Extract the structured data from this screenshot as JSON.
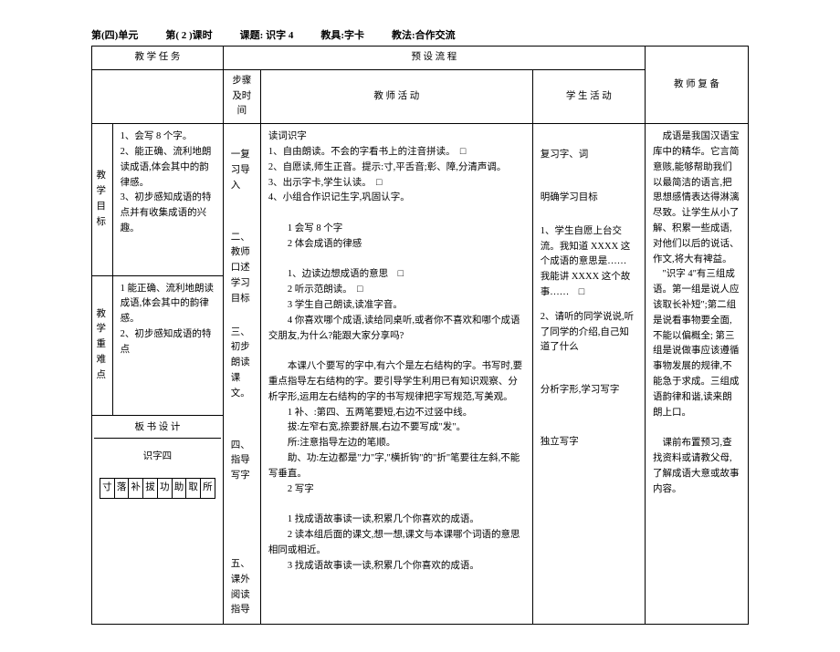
{
  "header": {
    "unit": "第(四)单元",
    "period": "第( 2 )课时",
    "topic": "课题: 识字 4",
    "tool": "教具:字卡",
    "method": "教法:合作交流"
  },
  "colHeaders": {
    "task": "教 学 任 务",
    "flow": "预 设 流 程",
    "step": "步骤及时间",
    "teacher": "教 师 活 动",
    "student": "学 生 活 动",
    "notes": "教 师 复 备"
  },
  "rowHeaders": {
    "goal": "教学目标",
    "keypoint": "教学重难点",
    "board": "板 书 设 计"
  },
  "goal": {
    "l1": "1、会写 8 个字。",
    "l2": "2、能正确、流利地朗读成语,体会其中的韵律感。",
    "l3": "3、初步感知成语的特点并有收集成语的兴趣。"
  },
  "keypoint": {
    "l1": "1 能正确、流利地朗读成语,体会其中的韵律感。",
    "l2": "2、初步感知成语的特点"
  },
  "board": {
    "title": "识字四",
    "c1": "寸",
    "c2": "落",
    "c3": "补",
    "c4": "拔",
    "c5": "功",
    "c6": "助",
    "c7": "取",
    "c8": "所"
  },
  "steps": {
    "s1": "一复习导入",
    "s2": "二、教师口述学习目标",
    "s3": "三、初步朗读课文。",
    "s4": "四、指导写字",
    "s5": "五、课外阅读指导"
  },
  "teacher": {
    "s1a": "读词识字",
    "s1b": "1、自由朗读。不会的字看书上的注音拼读。　□",
    "s1c": "2、自愿读,师生正音。提示:寸,平舌音;彰、障,分清声调。",
    "s1d": "3、出示字卡,学生认读。　□",
    "s1e": "4、小组合作识记生字,巩固认字。",
    "s2a": "1 会写 8 个字",
    "s2b": "2 体会成语的律感",
    "s3a": "1、边读边想成语的意思　□",
    "s3b": "2 听示范朗读。　□",
    "s3c": "3 学生自己朗读,读准字音。",
    "s3d": "4 你喜欢哪个成语,读给同桌听,或者你不喜欢和哪个成语交朋友,为什么?能跟大家分享吗?",
    "s4a": "本课八个要写的字中,有六个是左右结构的字。书写时,要重点指导左右结构的字。要引导学生利用已有知识观察、分析字形,运用左右结构的字的书写规律把字写规范,写美观。",
    "s4b": "1 补、:第四、五两笔要短,右边不过竖中线。",
    "s4c": "拔:左窄右宽,捺要舒展,右边不要写成\"发\"。",
    "s4d": "所:注意指导左边的笔顺。",
    "s4e": "助、功:左边都是\"力\"字,\"横折钩\"的\"折\"笔要往左斜,不能写垂直。",
    "s4f": "2 写字",
    "s5a": "1 找成语故事读一读,积累几个你喜欢的成语。",
    "s5b": "2 读本组后面的课文,想一想,课文与本课哪个词语的意思相同或相近。",
    "s5c": "3 找成语故事读一读,积累几个你喜欢的成语。"
  },
  "student": {
    "s1a": "复习字、词",
    "s1b": "明确学习目标",
    "s2a": "1、学生自愿上台交流。我知道 XXXX 这个成语的意思是……　我能讲 XXXX 这个故事……　□",
    "s2b": "2、请听的同学说说,听了同学的介绍,自己知道了什么",
    "s3a": "分析字形,学习写字",
    "s3b": "独立写字"
  },
  "notes": {
    "p1": "成语是我国汉语宝库中的精华。它言简意赅,能够帮助我们以最简洁的语言,把思想感情表达得淋漓尽致。让学生从小了解、积累一些成语,对他们以后的说话、作文,将大有裨益。",
    "p2": "\"识字 4\"有三组成语。第一组是说人应该取长补短\";第二组是说看事物要全面,不能以偏概全; 第三组是说做事应该遵循事物发展的规律,不能急于求成。三组成语韵律和谐,读来朗朗上口。",
    "p3": "课前布置预习,查找资料或请教父母,了解成语大意或故事内容。"
  }
}
